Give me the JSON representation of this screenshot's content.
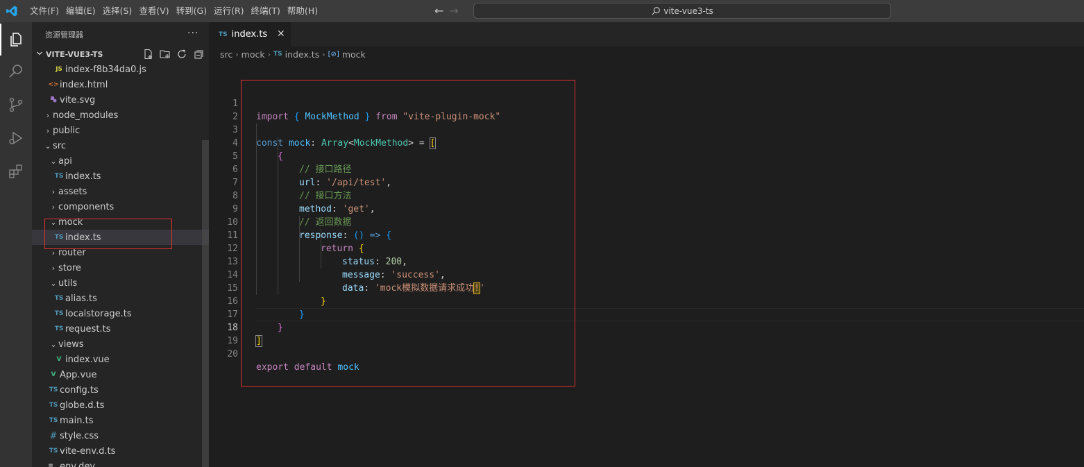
{
  "menu": [
    "文件(F)",
    "编辑(E)",
    "选择(S)",
    "查看(V)",
    "转到(G)",
    "运行(R)",
    "终端(T)",
    "帮助(H)"
  ],
  "command_center": {
    "text": "vite-vue3-ts"
  },
  "sidebar": {
    "header": "资源管理器",
    "more": "···",
    "section": "VITE-VUE3-TS",
    "items": [
      {
        "label": "index-f8b34da0.js",
        "icon": "JS"
      },
      {
        "label": "index.html",
        "icon": "<>"
      },
      {
        "label": "vite.svg",
        "icon": "svg"
      },
      {
        "label": "node_modules"
      },
      {
        "label": "public"
      },
      {
        "label": "src"
      },
      {
        "label": "api"
      },
      {
        "label": "index.ts",
        "icon": "TS"
      },
      {
        "label": "assets"
      },
      {
        "label": "components"
      },
      {
        "label": "mock"
      },
      {
        "label": "index.ts",
        "icon": "TS"
      },
      {
        "label": "router"
      },
      {
        "label": "store"
      },
      {
        "label": "utils"
      },
      {
        "label": "alias.ts",
        "icon": "TS"
      },
      {
        "label": "localstorage.ts",
        "icon": "TS"
      },
      {
        "label": "request.ts",
        "icon": "TS"
      },
      {
        "label": "views"
      },
      {
        "label": "index.vue",
        "icon": "V"
      },
      {
        "label": "App.vue",
        "icon": "V"
      },
      {
        "label": "config.ts",
        "icon": "TS"
      },
      {
        "label": "globe.d.ts",
        "icon": "TS"
      },
      {
        "label": "main.ts",
        "icon": "TS"
      },
      {
        "label": "style.css",
        "icon": "#"
      },
      {
        "label": "vite-env.d.ts",
        "icon": "TS"
      },
      {
        "label": ".env.dev",
        "icon": "≡"
      }
    ]
  },
  "tab": {
    "label": "index.ts",
    "icon": "TS",
    "close": "✕"
  },
  "breadcrumb": [
    "src",
    "mock",
    "index.ts",
    "mock"
  ],
  "code": {
    "line_numbers": [
      "1",
      "2",
      "3",
      "4",
      "5",
      "6",
      "7",
      "8",
      "9",
      "10",
      "11",
      "12",
      "13",
      "14",
      "15",
      "16",
      "17",
      "18",
      "19",
      "20"
    ],
    "current_line": "18",
    "t1": {
      "import": "import",
      "ob": "{",
      "name": "MockMethod",
      "cb": "}",
      "from": "from",
      "src": "\"vite-plugin-mock\""
    },
    "t3": {
      "const": "const",
      "mock": "mock",
      "colon": ":",
      "array": "Array",
      "lt": "<",
      "type": "MockMethod",
      "gt": ">",
      "eq": "=",
      "ob": "["
    },
    "t4": "{",
    "t5": "// 接口路径",
    "t6": {
      "key": "url",
      "colon": ":",
      "val": "'/api/test'",
      "comma": ","
    },
    "t7": "// 接口方法",
    "t8": {
      "key": "method",
      "colon": ":",
      "val": "'get'",
      "comma": ","
    },
    "t9": "// 返回数据",
    "t10": {
      "key": "response",
      "colon": ":",
      "paren": "()",
      "arrow": "=>",
      "ob": "{"
    },
    "t11": {
      "ret": "return",
      "ob": "{"
    },
    "t12": {
      "key": "status",
      "colon": ":",
      "val": "200",
      "comma": ","
    },
    "t13": {
      "key": "message",
      "colon": ":",
      "val": "'success'",
      "comma": ","
    },
    "t14": {
      "key": "data",
      "colon": ":",
      "val": "'mock模拟数据请求成功",
      "warn": "!",
      "end": "'"
    },
    "t15": "}",
    "t16": "}",
    "t17": "}",
    "t18": "]",
    "t20": {
      "export": "export",
      "default": "default",
      "mock": "mock"
    }
  },
  "colors": {
    "accent": "#007acc",
    "highlight_border": "#e03030"
  }
}
